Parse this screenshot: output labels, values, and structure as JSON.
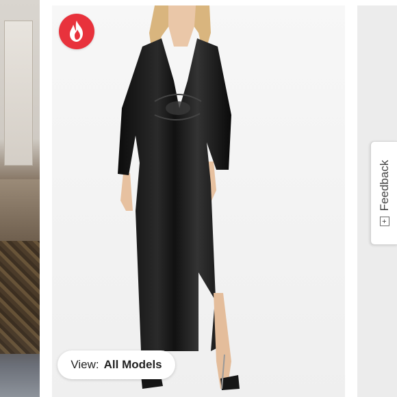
{
  "carousel": {
    "hot_badge_icon": "flame-icon",
    "badge_color": "#e8323c",
    "view_selector": {
      "label": "View:",
      "value": "All Models"
    }
  },
  "feedback": {
    "icon": "plus-box-icon",
    "icon_glyph": "+",
    "label": "Feedback"
  }
}
